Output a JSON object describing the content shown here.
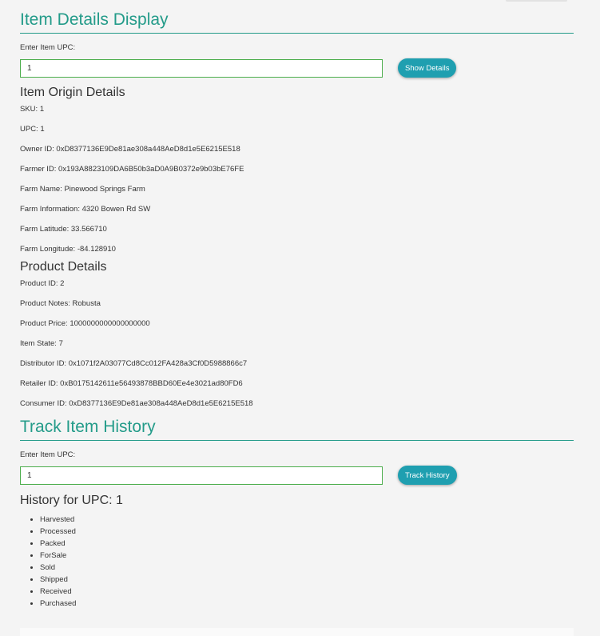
{
  "item_details": {
    "title": "Item Details Display",
    "upc_label": "Enter Item UPC:",
    "upc_value": "1",
    "button_label": "Show Details",
    "origin_title": "Item Origin Details",
    "origin_fields": [
      {
        "label": "SKU:",
        "value": "1"
      },
      {
        "label": "UPC:",
        "value": "1"
      },
      {
        "label": "Owner ID:",
        "value": "0xD8377136E9De81ae308a448AeD8d1e5E6215E518"
      },
      {
        "label": "Farmer ID:",
        "value": "0x193A8823109DA6B50b3aD0A9B0372e9b03bE76FE"
      },
      {
        "label": "Farm Name:",
        "value": "Pinewood Springs Farm"
      },
      {
        "label": "Farm Information:",
        "value": "4320 Bowen Rd SW"
      },
      {
        "label": "Farm Latitude:",
        "value": "33.566710"
      },
      {
        "label": "Farm Longitude:",
        "value": "-84.128910"
      }
    ],
    "product_title": "Product Details",
    "product_fields": [
      {
        "label": "Product ID:",
        "value": "2"
      },
      {
        "label": "Product Notes:",
        "value": "Robusta"
      },
      {
        "label": "Product Price:",
        "value": "1000000000000000000"
      },
      {
        "label": "Item State:",
        "value": "7"
      },
      {
        "label": "Distributor ID:",
        "value": "0x1071f2A03077Cd8Cc012FA428a3Cf0D5988866c7"
      },
      {
        "label": "Retailer ID:",
        "value": "0xB0175142611e56493878BBD60Ee4e3021ad80FD6"
      },
      {
        "label": "Consumer ID:",
        "value": "0xD8377136E9De81ae308a448AeD8d1e5E6215E518"
      }
    ]
  },
  "track_history": {
    "title": "Track Item History",
    "upc_label": "Enter Item UPC:",
    "upc_value": "1",
    "button_label": "Track History",
    "history_title": "History for UPC: 1",
    "history_items": [
      "Harvested",
      "Processed",
      "Packed",
      "ForSale",
      "Sold",
      "Shipped",
      "Received",
      "Purchased"
    ]
  },
  "colors": {
    "accent": "#239b89",
    "button": "#1f9fb0",
    "input_border": "#4cae4c"
  }
}
